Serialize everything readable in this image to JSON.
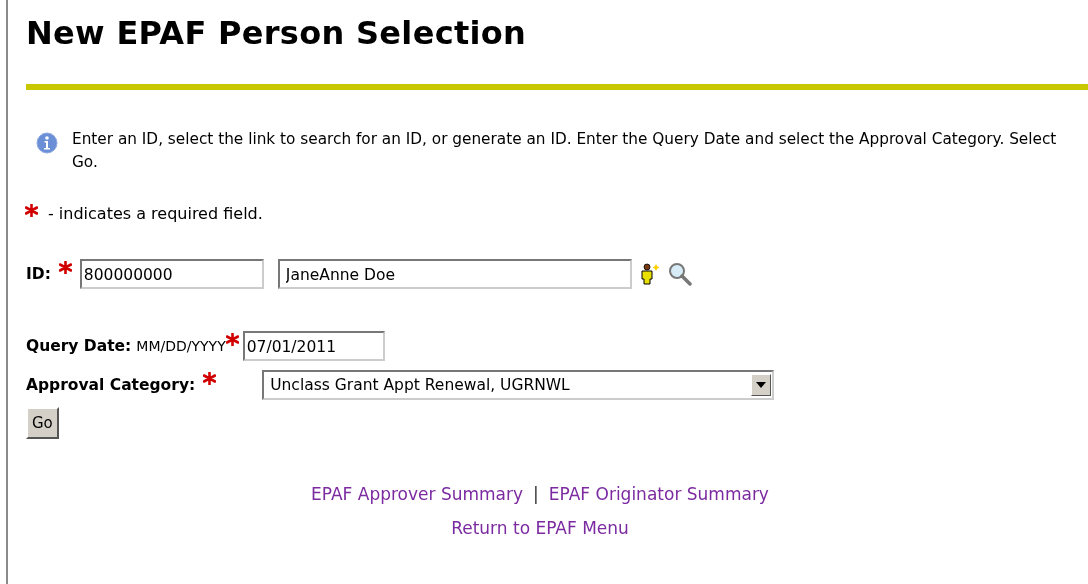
{
  "page": {
    "title": "New EPAF Person Selection"
  },
  "info": {
    "text": "Enter an ID, select the link to search for an ID, or generate an ID. Enter the Query Date and select the Approval Category. Select Go."
  },
  "required_note": {
    "text": "- indicates a required field."
  },
  "form": {
    "id_label": "ID:",
    "id_value": "800000000",
    "name_value": "JaneAnne Doe",
    "date_label": "Query Date:",
    "date_format": "MM/DD/YYYY",
    "date_value": "07/01/2011",
    "category_label": "Approval Category:",
    "category_value": "Unclass Grant Appt Renewal, UGRNWL",
    "go_button": "Go"
  },
  "links": {
    "row_1": [
      "EPAF Approver Summary",
      "EPAF Originator Summary"
    ],
    "separator": "|",
    "row_2": [
      "Return to EPAF Menu"
    ]
  }
}
